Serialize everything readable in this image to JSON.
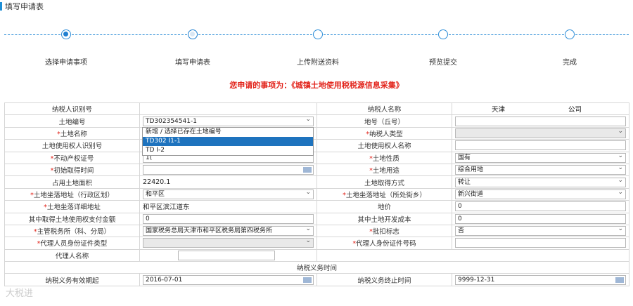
{
  "header": {
    "title": "填写申请表"
  },
  "steps": [
    {
      "label": "选择申请事项",
      "state": "done"
    },
    {
      "label": "填写申请表",
      "state": "current"
    },
    {
      "label": "上传附送资料",
      "state": "todo"
    },
    {
      "label": "预览提交",
      "state": "todo"
    },
    {
      "label": "完成",
      "state": "todo"
    }
  ],
  "notice": "您申请的事项为：《城镇土地使用税税源信息采集》",
  "form": {
    "taxpayer_id_label": "纳税人识别号",
    "taxpayer_name_label": "纳税人名称",
    "taxpayer_name_value_a": "天津",
    "taxpayer_name_value_b": "公司",
    "land_no_label": "土地编号",
    "land_no_value": "TD302354541-1",
    "plot_no_label": "地号（丘号）",
    "land_name_label": "土地名称",
    "taxpayer_type_label": "纳税人类型",
    "user_id_label": "土地使用权人识别号",
    "user_name_label": "土地使用权人名称",
    "property_cert_label": "不动产权证号",
    "property_cert_value": "1(",
    "land_nature_label": "土地性质",
    "land_nature_value": "国有",
    "acquire_time_label": "初始取得时间",
    "land_use_label": "土地用途",
    "land_use_value": "综合用地",
    "area_label": "占用土地面积",
    "area_value": "22420.1",
    "acquire_method_label": "土地取得方式",
    "acquire_method_value": "转让",
    "address_district_label": "土地坐落地址（行政区划）",
    "address_district_value": "和平区",
    "address_street_label": "土地坐落地址（所处街乡）",
    "address_street_value": "新兴街道",
    "address_detail_label": "土地坐落详细地址",
    "address_detail_value": "和平区滨江道东",
    "land_price_label": "地价",
    "land_price_value": "0",
    "use_fee_label": "其中取得土地使用权支付金额",
    "use_fee_value": "0",
    "dev_cost_label": "其中土地开发成本",
    "dev_cost_value": "0",
    "tax_office_label": "主管税务所（科、分局）",
    "tax_office_value": "国家税务总局天津市和平区税务局第四税务所",
    "approve_flag_label": "批扣标志",
    "approve_flag_value": "否",
    "agent_id_type_label": "代理人员身份证件类型",
    "agent_id_no_label": "代理人身份证件号码",
    "agent_name_label": "代理人名称",
    "tax_period_header": "纳税义务时间",
    "period_start_label": "纳税义务有效期起",
    "period_start_value": "2016-07-01",
    "period_end_label": "纳税义务终止时间",
    "period_end_value": "9999-12-31"
  },
  "dropdown_options": [
    "新增 / 选择已存在土地编号",
    "TD302            I1-1",
    "TD               I-2"
  ],
  "watermark": "大税进"
}
